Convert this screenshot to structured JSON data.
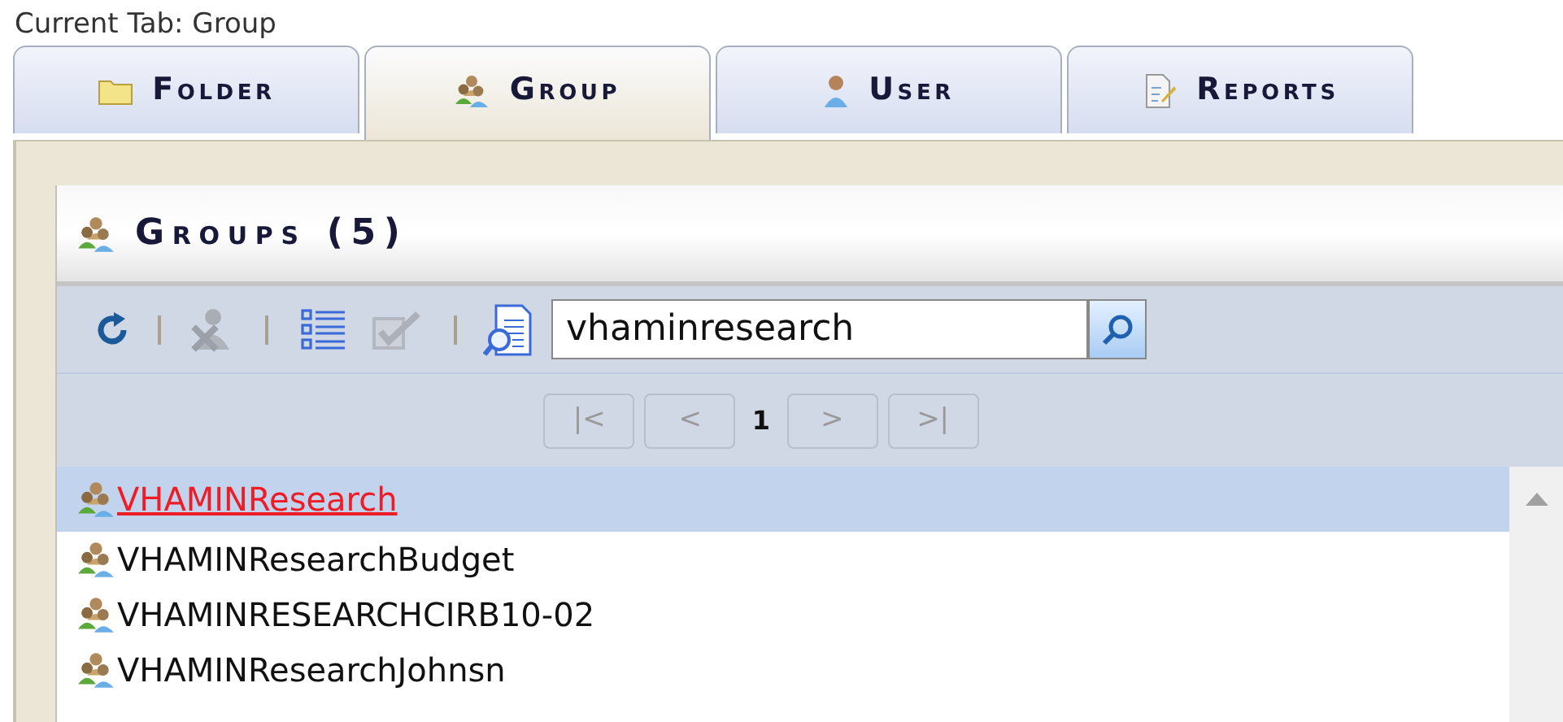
{
  "current_tab_label": "Current Tab: Group",
  "tabs": [
    {
      "label": "Folder",
      "kind": "folder",
      "selected": false
    },
    {
      "label": "Group",
      "kind": "group",
      "selected": true
    },
    {
      "label": "User",
      "kind": "user",
      "selected": false
    },
    {
      "label": "Reports",
      "kind": "reports",
      "selected": false
    }
  ],
  "panel": {
    "title": "Groups (5)"
  },
  "toolbar": [
    {
      "kind": "refresh",
      "disabled": false
    },
    {
      "kind": "separator"
    },
    {
      "kind": "delete-group",
      "disabled": true
    },
    {
      "kind": "separator"
    },
    {
      "kind": "list",
      "disabled": false
    },
    {
      "kind": "check",
      "disabled": true
    },
    {
      "kind": "separator"
    },
    {
      "kind": "search-doc",
      "disabled": false
    }
  ],
  "search": {
    "value": "vhaminresearch"
  },
  "pager": [
    {
      "label": "|<",
      "kind": "button",
      "disabled": true
    },
    {
      "label": "<",
      "kind": "button",
      "disabled": true
    },
    {
      "label": "1",
      "kind": "page"
    },
    {
      "label": ">",
      "kind": "button",
      "disabled": true
    },
    {
      "label": ">|",
      "kind": "button",
      "disabled": true
    }
  ],
  "groups": [
    {
      "name": "VHAMINResearch",
      "selected": true
    },
    {
      "name": "VHAMINResearchBudget",
      "selected": false
    },
    {
      "name": "VHAMINRESEARCHCIRB10-02",
      "selected": false
    },
    {
      "name": "VHAMINResearchJohnsn",
      "selected": false
    }
  ]
}
